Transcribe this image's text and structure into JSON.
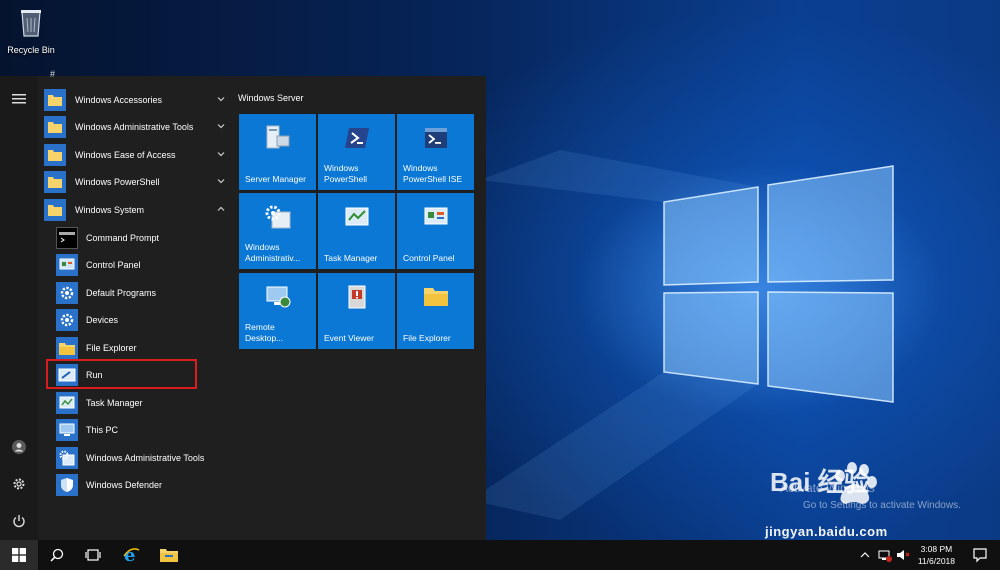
{
  "desktop": {
    "recycle_bin_label": "Recycle Bin",
    "watermark_activate": "Activate Windows",
    "watermark_activate_sub": "Go to Settings to activate Windows.",
    "watermark_brand": "Bai 经验",
    "watermark_url": "jingyan.baidu.com"
  },
  "start_menu": {
    "scroll_letter": "#",
    "folders": [
      {
        "label": "Windows Accessories",
        "expanded": false
      },
      {
        "label": "Windows Administrative Tools",
        "expanded": false
      },
      {
        "label": "Windows Ease of Access",
        "expanded": false
      },
      {
        "label": "Windows PowerShell",
        "expanded": false
      },
      {
        "label": "Windows System",
        "expanded": true
      }
    ],
    "system_items": [
      {
        "label": "Command Prompt",
        "icon": "command-prompt-icon"
      },
      {
        "label": "Control Panel",
        "icon": "control-panel-icon"
      },
      {
        "label": "Default Programs",
        "icon": "gear-icon"
      },
      {
        "label": "Devices",
        "icon": "gear-icon"
      },
      {
        "label": "File Explorer",
        "icon": "folder-icon"
      },
      {
        "label": "Run",
        "icon": "run-icon",
        "highlighted": true
      },
      {
        "label": "Task Manager",
        "icon": "task-manager-icon"
      },
      {
        "label": "This PC",
        "icon": "computer-icon"
      },
      {
        "label": "Windows Administrative Tools",
        "icon": "admin-tools-icon"
      },
      {
        "label": "Windows Defender",
        "icon": "shield-icon"
      }
    ],
    "tiles_group_title": "Windows Server",
    "tiles": [
      {
        "label_line1": "Server Manager",
        "label_line2": ""
      },
      {
        "label_line1": "Windows",
        "label_line2": "PowerShell"
      },
      {
        "label_line1": "Windows",
        "label_line2": "PowerShell ISE"
      },
      {
        "label_line1": "Windows",
        "label_line2": "Administrativ..."
      },
      {
        "label_line1": "Task Manager",
        "label_line2": ""
      },
      {
        "label_line1": "Control Panel",
        "label_line2": ""
      },
      {
        "label_line1": "Remote",
        "label_line2": "Desktop..."
      },
      {
        "label_line1": "Event Viewer",
        "label_line2": ""
      },
      {
        "label_line1": "File Explorer",
        "label_line2": ""
      }
    ]
  },
  "taskbar": {
    "time": "3:08 PM",
    "date": "11/6/2018"
  },
  "colors": {
    "tile_blue": "#0a78d4",
    "highlight_red": "#d81e1e",
    "start_bg": "#1f1f1f"
  }
}
